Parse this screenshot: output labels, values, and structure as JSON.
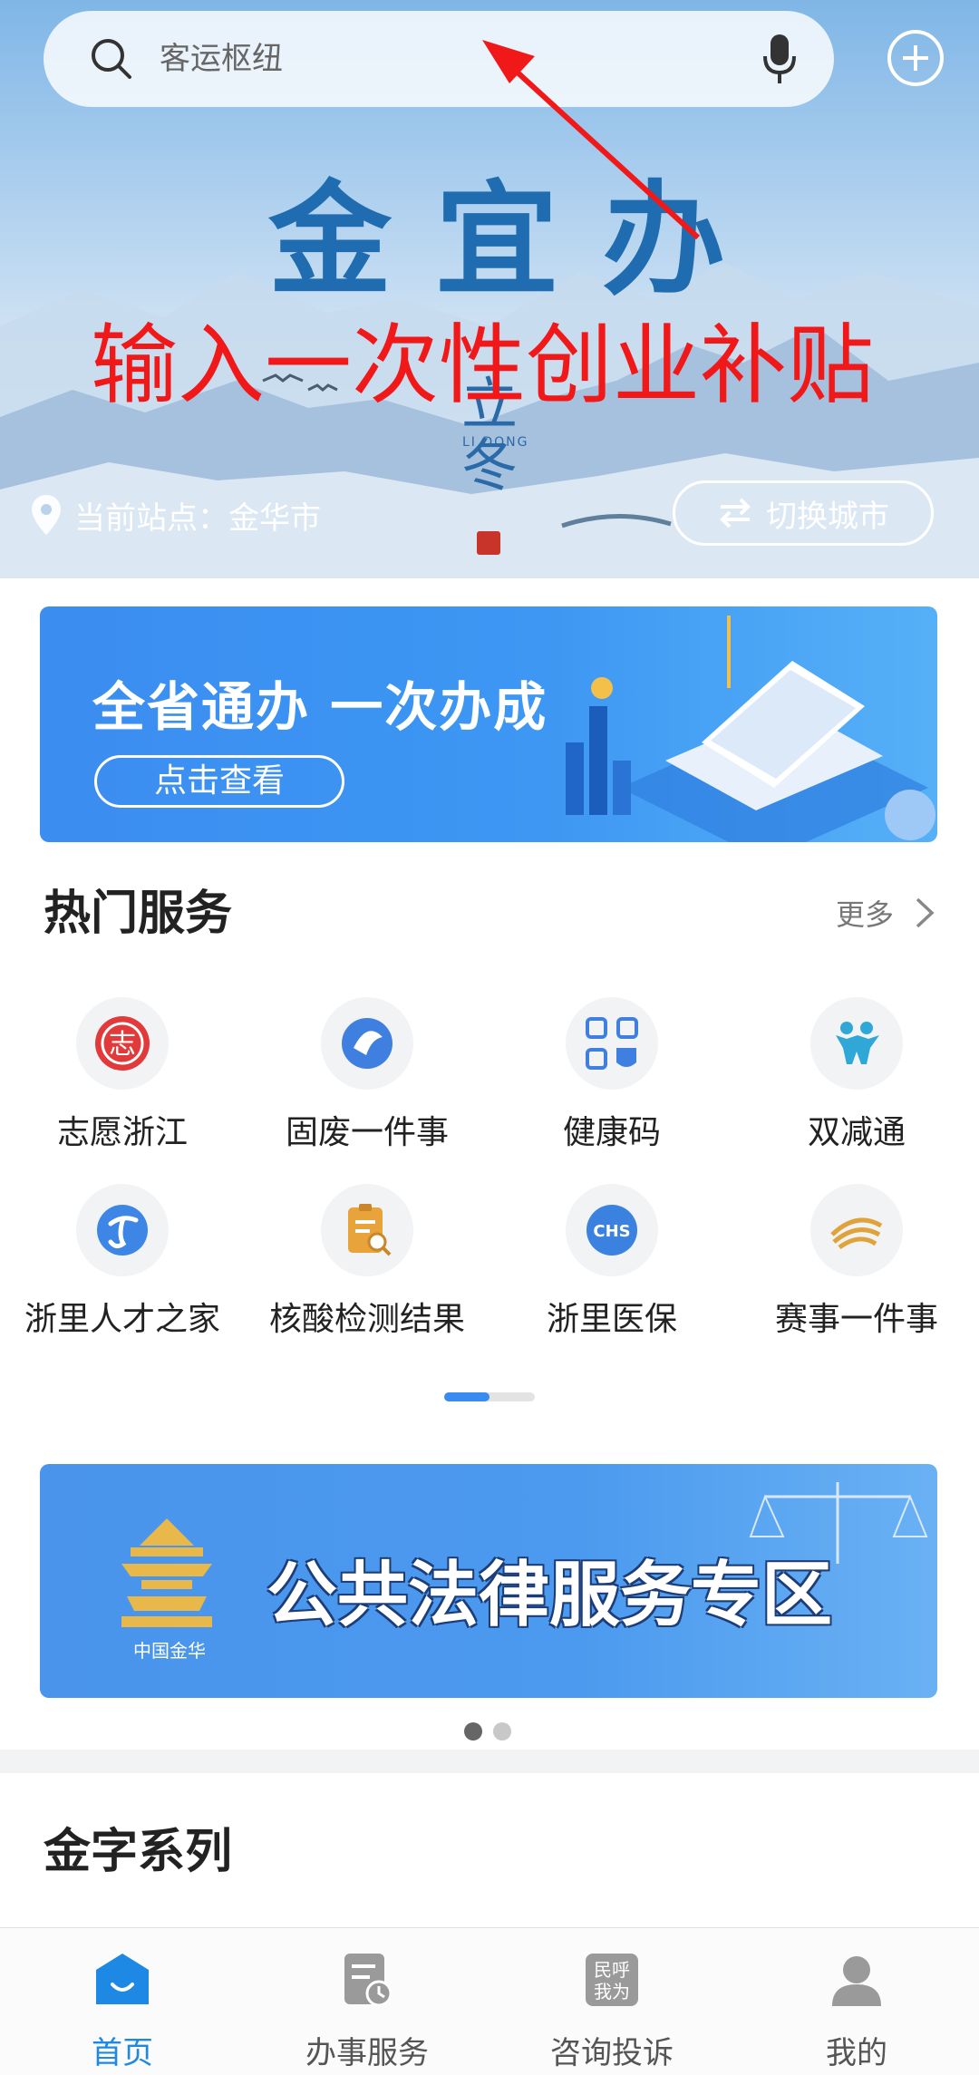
{
  "search": {
    "placeholder": "客运枢纽"
  },
  "hero": {
    "title": "金宜办",
    "overlay_text": "输入一次性创业补贴",
    "solar_term": "立冬",
    "solar_term_en": "LI DONG",
    "location_label": "当前站点：金华市",
    "switch_city_label": "切换城市"
  },
  "banner1": {
    "title": "全省通办 一次办成",
    "button_label": "点击查看"
  },
  "hot_services": {
    "title": "热门服务",
    "more_label": "更多",
    "items": [
      {
        "label": "志愿浙江",
        "icon": "zhiyuan-icon"
      },
      {
        "label": "固废一件事",
        "icon": "solid-waste-icon"
      },
      {
        "label": "健康码",
        "icon": "health-code-icon"
      },
      {
        "label": "双减通",
        "icon": "double-reduction-icon"
      },
      {
        "label": "浙里人才之家",
        "icon": "talent-home-icon"
      },
      {
        "label": "核酸检测结果",
        "icon": "nucleic-test-icon"
      },
      {
        "label": "浙里医保",
        "icon": "medical-insurance-icon"
      },
      {
        "label": "赛事一件事",
        "icon": "sports-event-icon"
      }
    ],
    "page": 1,
    "pages": 2
  },
  "banner2": {
    "title": "公共法律服务专区",
    "logo_caption": "中国金华"
  },
  "series": {
    "title": "金字系列"
  },
  "tabbar": {
    "items": [
      {
        "label": "首页",
        "icon": "home-icon",
        "active": true
      },
      {
        "label": "办事服务",
        "icon": "service-icon",
        "active": false
      },
      {
        "label": "咨询投诉",
        "icon": "complaint-icon",
        "active": false
      },
      {
        "label": "我的",
        "icon": "profile-icon",
        "active": false
      }
    ]
  },
  "colors": {
    "accent": "#1e88e5",
    "overlay_red": "#f01818",
    "banner_blue": "#3b8df0"
  }
}
